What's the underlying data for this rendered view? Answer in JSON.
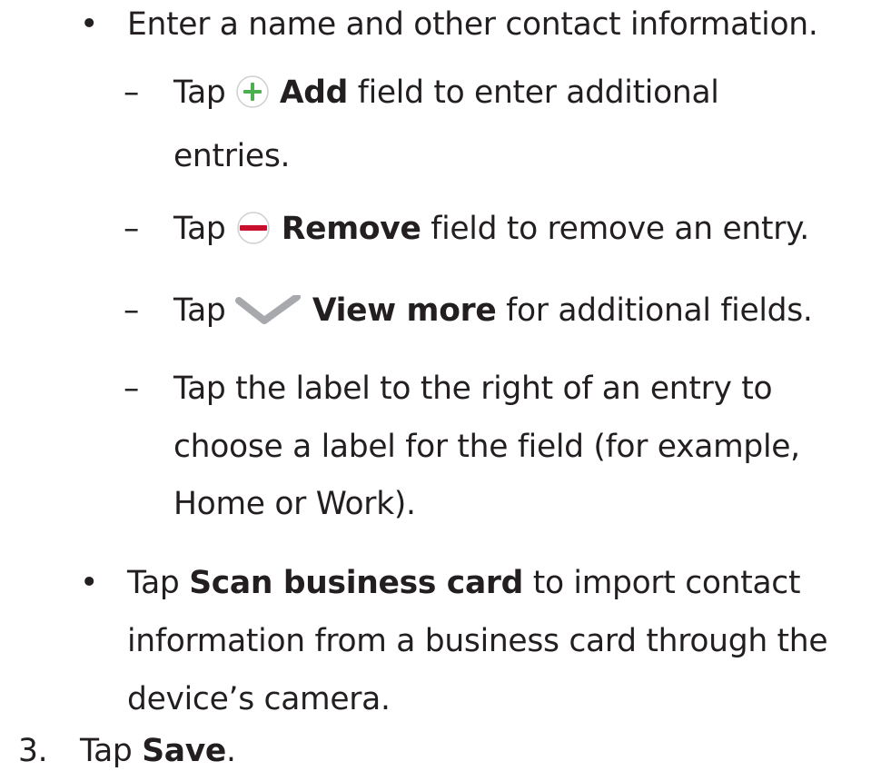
{
  "bullets": {
    "dot": "•",
    "dash": "–",
    "step_number": "3."
  },
  "items": {
    "enter_name": "Enter a name and other contact information.",
    "add": {
      "prefix": "Tap",
      "icon": "add-circle-icon",
      "bold": "Add",
      "suffix": "field to enter additional",
      "continuation": "entries."
    },
    "remove": {
      "prefix": "Tap",
      "icon": "remove-circle-icon",
      "bold": "Remove",
      "suffix": "field to remove an entry."
    },
    "view_more": {
      "prefix": "Tap",
      "icon": "chevron-down-icon",
      "bold": "View more",
      "suffix": "for additional fields."
    },
    "label": {
      "line1": "Tap the label to the right of an entry to",
      "line2": "choose a label for the field (for example,",
      "line3": "Home or Work)."
    },
    "scan": {
      "prefix": "Tap",
      "bold": "Scan business card",
      "suffix": "to import contact",
      "line2": "information from a business card through the",
      "line3": "device’s camera."
    },
    "save": {
      "prefix": "Tap",
      "bold": "Save",
      "suffix": "."
    }
  },
  "colors": {
    "text": "#231f20",
    "add_icon": "#4caf50",
    "remove_icon": "#c8102e",
    "chevron_icon": "#a7a9ac",
    "icon_ring": "#cfcfcf"
  }
}
